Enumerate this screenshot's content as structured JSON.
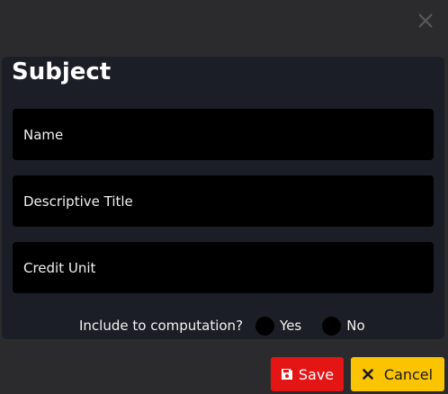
{
  "dialog": {
    "title": "Subject",
    "close_icon": "close-icon"
  },
  "form": {
    "name_placeholder": "Name",
    "name_value": "",
    "descriptive_title_placeholder": "Descriptive Title",
    "descriptive_title_value": "",
    "credit_unit_placeholder": "Credit Unit",
    "credit_unit_value": "",
    "computation": {
      "question": "Include to computation?",
      "options": [
        "Yes",
        "No"
      ],
      "selected": ""
    }
  },
  "actions": {
    "save_label": "Save",
    "save_icon": "floppy-disk-icon",
    "cancel_label": "Cancel",
    "cancel_icon": "times-icon"
  },
  "colors": {
    "background": "#2b2b2d",
    "card": "#1b1e26",
    "input": "#000000",
    "save": "#e41515",
    "cancel": "#fbc400"
  }
}
